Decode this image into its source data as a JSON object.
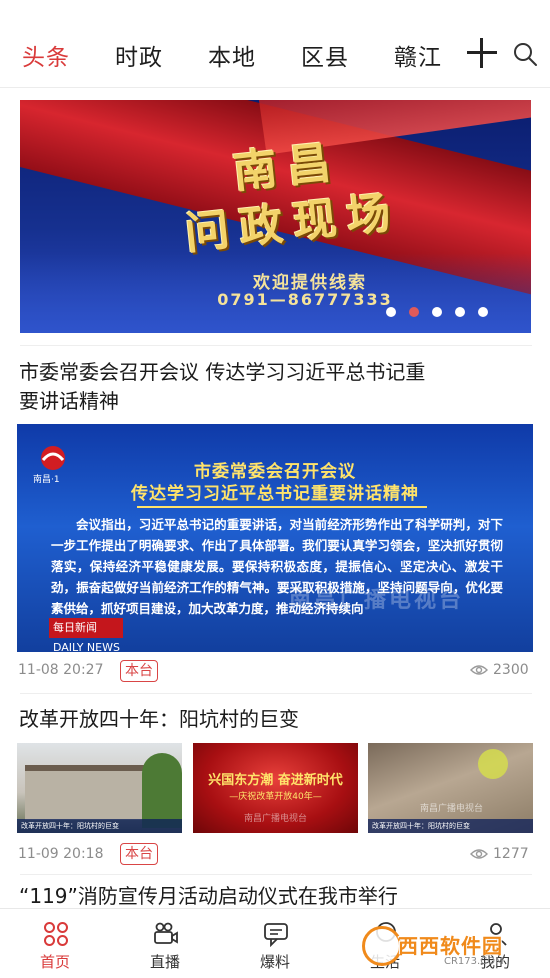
{
  "tabs": [
    {
      "label": "头条",
      "active": true
    },
    {
      "label": "时政"
    },
    {
      "label": "本地"
    },
    {
      "label": "区县"
    },
    {
      "label": "赣江"
    }
  ],
  "icons": {
    "add": "plus-icon",
    "search": "search-icon"
  },
  "banner": {
    "title_line1": "南昌",
    "title_line2": "问政现场",
    "subtitle": "欢迎提供线索",
    "phone": "0791—86777333",
    "dots_count": 5,
    "active_dot": 1
  },
  "news": [
    {
      "headline": "市委常委会召开会议 传达学习习近平总书记重要讲话精神",
      "image": {
        "channel_caption": "南昌·1",
        "title1": "市委常委会召开会议",
        "title2": "传达学习习近平总书记重要讲话精神",
        "body": "会议指出，习近平总书记的重要讲话，对当前经济形势作出了科学研判，对下一步工作提出了明确要求、作出了具体部署。我们要认真学习领会，坚决抓好贯彻落实，保持经济平稳健康发展。要保持积极态度，提振信心、坚定决心、激发干劲，振奋起做好当前经济工作的精气神。要采取积极措施，坚持问题导向，优化要素供给，抓好项目建设，加大改革力度，推动经济持续向",
        "watermark": "南昌广播电视台",
        "badge": "每日新闻 DAILY NEWS"
      },
      "time": "11-08 20:27",
      "tag": "本台",
      "views": "2300"
    },
    {
      "headline": "改革开放四十年：阳坑村的巨变",
      "thumbs": [
        {
          "caption": "改革开放四十年：阳坑村的巨变"
        },
        {
          "title": "兴国东方潮 奋进新时代",
          "subtitle": "—庆祝改革开放40年—",
          "watermark": "南昌广播电视台"
        },
        {
          "caption": "改革开放四十年：阳坑村的巨变",
          "watermark": "南昌广播电视台"
        }
      ],
      "time": "11-09 20:18",
      "tag": "本台",
      "views": "1277"
    },
    {
      "headline": "“119”消防宣传月活动启动仪式在我市举行"
    }
  ],
  "bottom_nav": [
    {
      "label": "首页",
      "icon": "home-grid-icon",
      "active": true
    },
    {
      "label": "直播",
      "icon": "video-camera-icon"
    },
    {
      "label": "爆料",
      "icon": "chat-bubble-icon"
    },
    {
      "label": "生活",
      "icon": "life-icon"
    },
    {
      "label": "我的",
      "icon": "user-icon"
    }
  ],
  "site_watermark": {
    "name": "西西软件园",
    "url": "CR173.COM"
  },
  "colors": {
    "accent": "#d93a3a",
    "text": "#1b1b1b",
    "meta": "#8c8c8c"
  }
}
